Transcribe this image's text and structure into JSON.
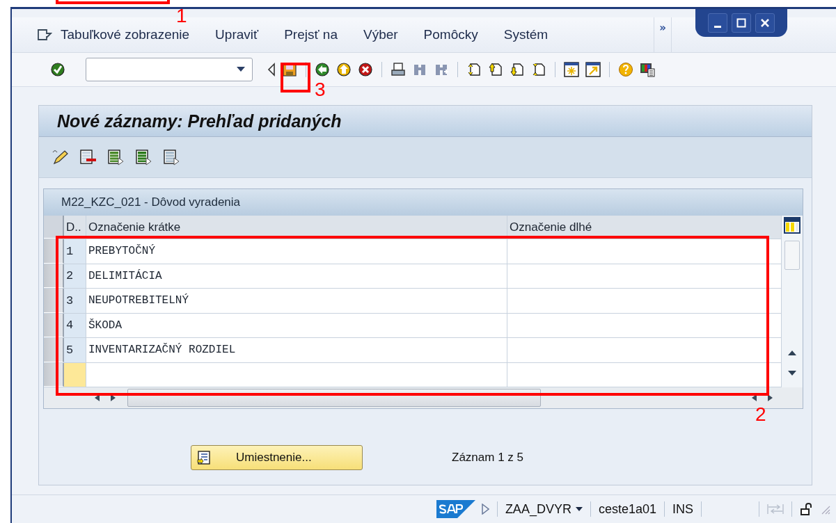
{
  "menu": {
    "items": [
      "Tabuľkové zobrazenie",
      "Upraviť",
      "Prejsť na",
      "Výber",
      "Pomôcky",
      "Systém"
    ],
    "overflow": "»"
  },
  "screen": {
    "title": "Nové záznamy: Prehľad pridaných"
  },
  "table": {
    "title": "M22_KZC_021  - Dôvod vyradenia",
    "columns": [
      "D..",
      "Označenie krátke",
      "Označenie dlhé"
    ],
    "rows": [
      {
        "number": "1",
        "short": "PREBYTOČNÝ",
        "focused": false
      },
      {
        "number": "2",
        "short": "DELIMITÁCIA",
        "focused": false
      },
      {
        "number": "3",
        "short": "NEUPOTREBITELNÝ",
        "focused": false
      },
      {
        "number": "4",
        "short": "ŠKODA",
        "focused": false
      },
      {
        "number": "5",
        "short": "INVENTARIZAČNÝ ROZDIEL",
        "focused": false
      },
      {
        "focused": true
      }
    ]
  },
  "position_button": "Umiestnenie...",
  "record_info": "Záznam 1 z 5",
  "status_bar": {
    "transaction": "ZAA_DVYR",
    "server": "ceste1a01",
    "mode": "INS"
  },
  "annotations": [
    "1",
    "2",
    "3"
  ]
}
